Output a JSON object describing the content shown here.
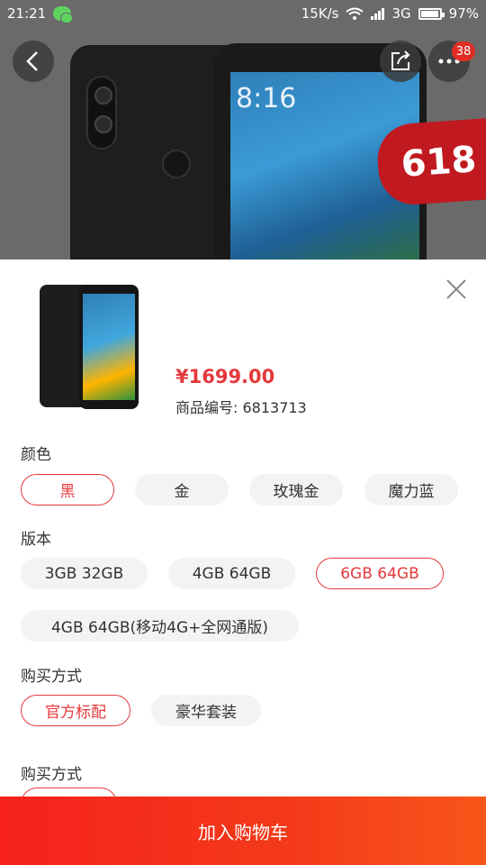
{
  "status_bar": {
    "time": "21:21",
    "speed": "15K/s",
    "network": "3G",
    "battery": "97%"
  },
  "hero": {
    "screen_time": "8:16",
    "promo_badge": "618",
    "notification_count": "38"
  },
  "product": {
    "price": "¥1699.00",
    "sku_label": "商品编号: 6813713"
  },
  "sections": {
    "color": {
      "label": "颜色",
      "options": [
        "黑",
        "金",
        "玫瑰金",
        "魔力蓝"
      ],
      "selected": "黑"
    },
    "version": {
      "label": "版本",
      "options": [
        "3GB 32GB",
        "4GB 64GB",
        "6GB 64GB",
        "4GB 64GB(移动4G+全网通版)"
      ],
      "selected": "6GB 64GB"
    },
    "purchase_1": {
      "label": "购买方式",
      "options": [
        "官方标配",
        "豪华套装"
      ],
      "selected": "官方标配"
    },
    "purchase_2": {
      "label": "购买方式"
    }
  },
  "cta": {
    "label": "加入购物车"
  },
  "colors": {
    "accent": "#e4393c",
    "cta_red": "#f6211c",
    "chip_bg": "#f3f3f3"
  }
}
